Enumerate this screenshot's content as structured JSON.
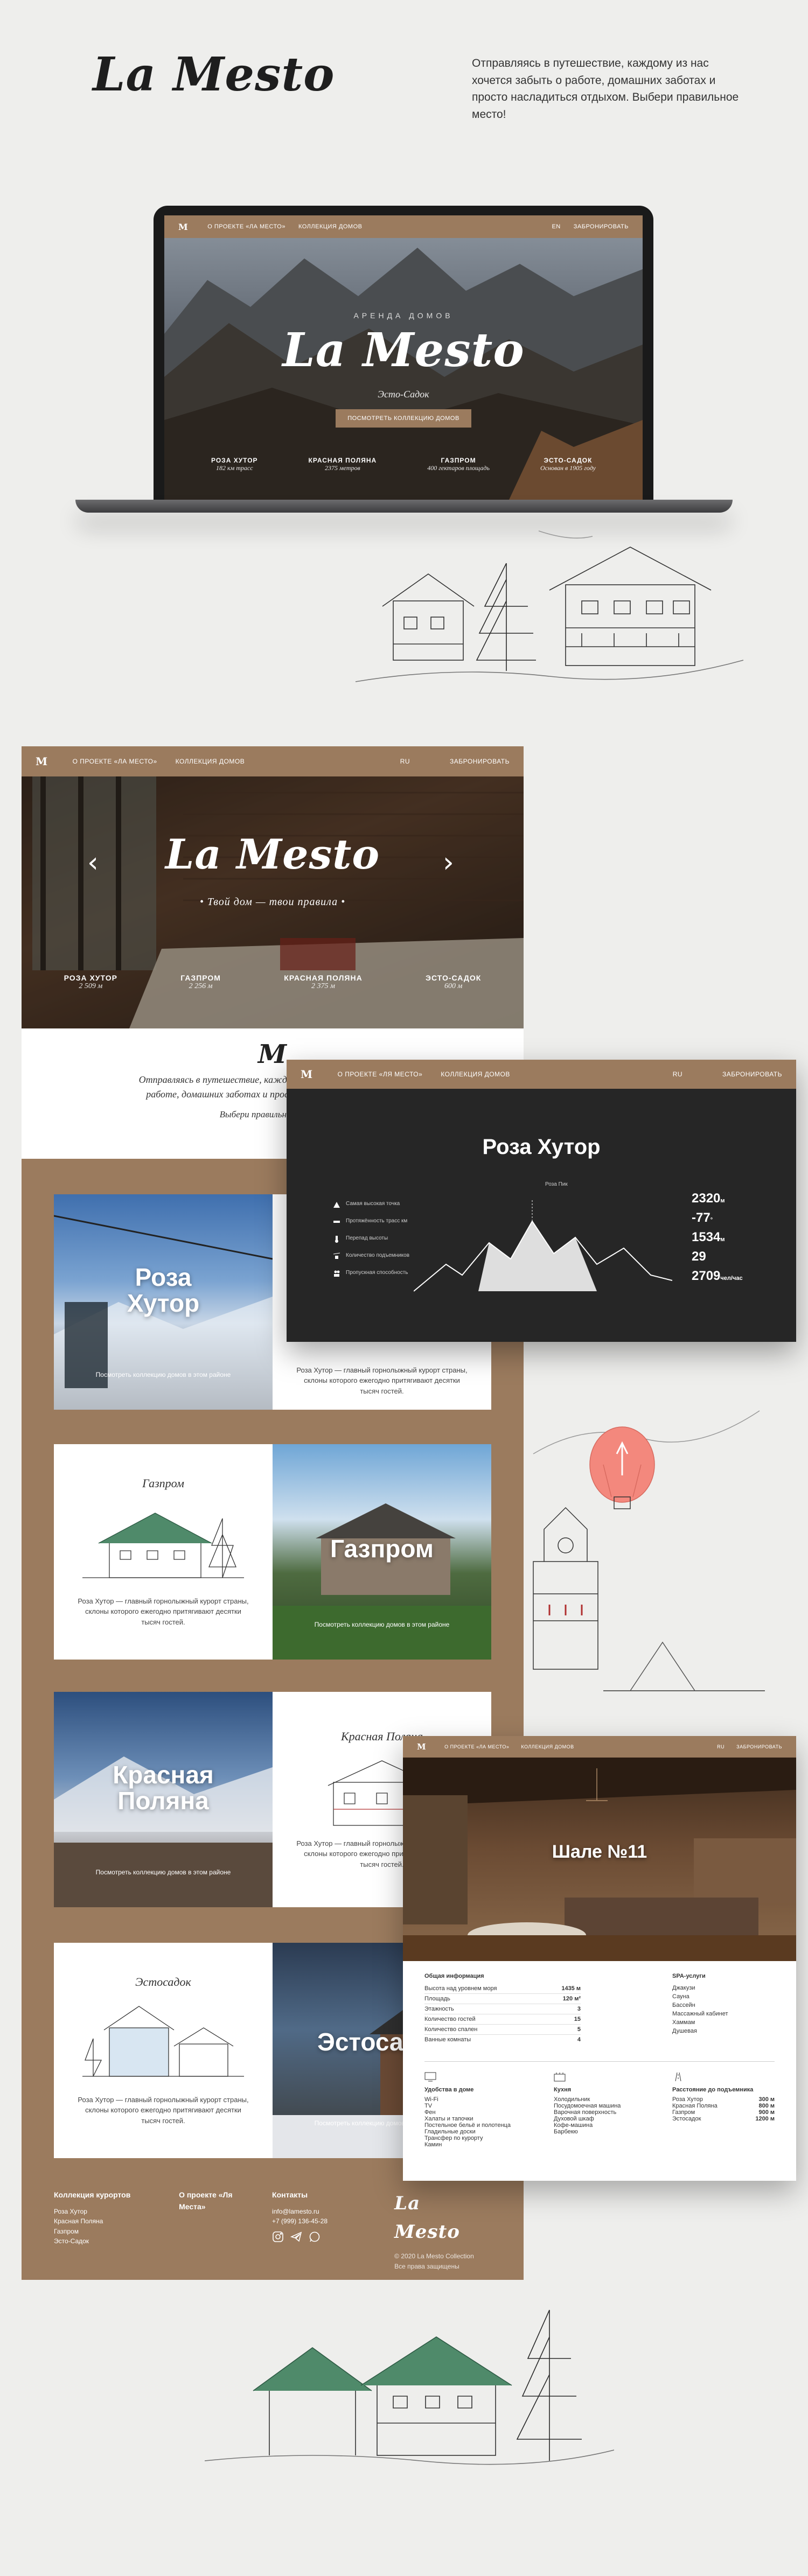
{
  "header": {
    "logo": "La Mesto",
    "tagline": "Отправляясь в путешествие, каждому из нас хочется забыть о работе, домашних заботах и просто насладиться отдыхом. Выбери правильное место!"
  },
  "laptop": {
    "nav": {
      "logo": "M",
      "about": "О ПРОЕКТЕ «ЛА МЕСТО»",
      "collection": "КОЛЛЕКЦИЯ ДОМОВ",
      "lang": "EN",
      "book": "ЗАБРОНИРОВАТЬ"
    },
    "hero": {
      "eyebrow": "АРЕНДА ДОМОВ",
      "title": "La Mesto",
      "subtitle": "Эсто-Садок",
      "button": "ПОСМОТРЕТЬ КОЛЛЕКЦИЮ ДОМОВ"
    },
    "stats": [
      {
        "title": "РОЗА ХУТОР",
        "value": "182 км трасс"
      },
      {
        "title": "КРАСНАЯ ПОЛЯНА",
        "value": "2375 метров"
      },
      {
        "title": "ГАЗПРОМ",
        "value": "400 гектаров площадь"
      },
      {
        "title": "ЭСТО-САДОК",
        "value": "Основан в 1905 году"
      }
    ]
  },
  "site": {
    "nav": {
      "logo": "M",
      "about": "О ПРОЕКТЕ «ЛА МЕСТО»",
      "collection": "КОЛЛЕКЦИЯ ДОМОВ",
      "lang": "RU",
      "book": "ЗАБРОНИРОВАТЬ"
    },
    "hero": {
      "title": "La Mesto",
      "slogan": "• Твой дом — твои правила •",
      "prev": "‹",
      "next": "›"
    },
    "stats": [
      {
        "title": "РОЗА ХУТОР",
        "value": "2 509 м"
      },
      {
        "title": "ГАЗПРОМ",
        "value": "2 256 м"
      },
      {
        "title": "КРАСНАЯ ПОЛЯНА",
        "value": "2 375 м"
      },
      {
        "title": "ЭСТО-САДОК",
        "value": "600 м"
      }
    ],
    "intro": {
      "logo": "M",
      "text": "Отправляясь в путешествие, каждому из нас хочется забыть о работе, домашних заботах и просто насладиться отдыхом.",
      "cta": "Выбери правильное место!"
    },
    "cards": [
      {
        "photo_title": "Роза Хутор",
        "photo_caption": "Посмотреть коллекцию домов в этом районе",
        "sketch_title": "",
        "desc": "Роза Хутор — главный горнолыжный курорт страны, склоны которого ежегодно притягивают десятки тысяч гостей."
      },
      {
        "photo_title": "Газпром",
        "photo_caption": "Посмотреть коллекцию домов в этом районе",
        "sketch_title": "Газпром",
        "desc": "Роза Хутор — главный горнолыжный курорт страны, склоны которого ежегодно притягивают десятки тысяч гостей."
      },
      {
        "photo_title": "Красная Поляна",
        "photo_caption": "Посмотреть коллекцию домов в этом районе",
        "sketch_title": "Красная Поляна",
        "desc": "Роза Хутор — главный горнолыжный курорт страны, склоны которого ежегодно притягивают десятки тысяч гостей."
      },
      {
        "photo_title": "Эстосадок",
        "photo_caption": "Посмотреть коллекцию домов в этом районе",
        "sketch_title": "Эстосадок",
        "desc": "Роза Хутор — главный горнолыжный курорт страны, склоны которого ежегодно притягивают десятки тысяч гостей."
      }
    ],
    "footer": {
      "col1_title": "Коллекция курортов",
      "col1_items": [
        "Роза Хутор",
        "Красная Поляна",
        "Газпром",
        "Эсто-Садок"
      ],
      "col2_title": "О проекте «Ля Места»",
      "col3_title": "Контакты",
      "email": "info@lamesto.ru",
      "phone": "+7 (999) 136-45-28",
      "logo": "La Mesto",
      "copyright": "© 2020 La Mesto Collection",
      "rights": "Все права защищены"
    }
  },
  "resort": {
    "nav": {
      "logo": "M",
      "about": "О ПРОЕКТЕ «ЛЯ МЕСТО»",
      "collection": "КОЛЛЕКЦИЯ ДОМОВ",
      "lang": "RU",
      "book": "ЗАБРОНИРОВАТЬ"
    },
    "title": "Роза Хутор",
    "peak": "Роза Пик",
    "legend": [
      {
        "icon": "mountain-icon",
        "label": "Самая высокая точка"
      },
      {
        "icon": "ruler-icon",
        "label": "Протяжённость трасс км"
      },
      {
        "icon": "thermometer-icon",
        "label": "Перепад высоты"
      },
      {
        "icon": "lift-icon",
        "label": "Количество подъемников"
      },
      {
        "icon": "people-icon",
        "label": "Пропускная способность"
      }
    ],
    "numbers": [
      {
        "value": "2320",
        "unit": "м"
      },
      {
        "value": "-77",
        "unit": "°"
      },
      {
        "value": "1534",
        "unit": "м"
      },
      {
        "value": "29",
        "unit": ""
      },
      {
        "value": "2709",
        "unit": "чел/час"
      }
    ]
  },
  "house": {
    "nav": {
      "logo": "M",
      "about": "О ПРОЕКТЕ «ЛА МЕСТО»",
      "collection": "КОЛЛЕКЦИЯ ДОМОВ",
      "lang": "RU",
      "book": "ЗАБРОНИРОВАТЬ"
    },
    "title": "Шале №11",
    "general_title": "Общая информация",
    "general": [
      {
        "label": "Высота над уровнем моря",
        "value": "1435 м"
      },
      {
        "label": "Площадь",
        "value": "120 м²"
      },
      {
        "label": "Этажность",
        "value": "3"
      },
      {
        "label": "Количество гостей",
        "value": "15"
      },
      {
        "label": "Количество спален",
        "value": "5"
      },
      {
        "label": "Ванные комнаты",
        "value": "4"
      }
    ],
    "spa_title": "SPA-услуги",
    "spa": [
      "Джакузи",
      "Сауна",
      "Бассейн",
      "Массажный кабинет",
      "Хаммам",
      "Душевая"
    ],
    "facilities": [
      {
        "icon": "tv-icon",
        "title": "Удобства в доме",
        "items": [
          "Wi-Fi",
          "TV",
          "Фен",
          "Халаты и тапочки",
          "Постельное бельё и полотенца",
          "Гладильные доски",
          "Трансфер по курорту",
          "Камин"
        ]
      },
      {
        "icon": "kitchen-icon",
        "title": "Кухня",
        "items": [
          "Холодильник",
          "Посудомоечная машина",
          "Варочная поверхность",
          "Духовой шкаф",
          "Кофе-машина",
          "Барбекю"
        ]
      },
      {
        "icon": "road-icon",
        "title": "Расстояние до подъемника",
        "items": [
          "Роза Хутор",
          "Красная Поляна",
          "Газпром",
          "Эстосадок"
        ],
        "values": [
          "300 м",
          "800 м",
          "900 м",
          "1200 м"
        ]
      }
    ]
  },
  "colors": {
    "brand": "#9b7b5e",
    "dark": "#262626",
    "bg": "#eeeeec",
    "balloon": "#f3887d"
  }
}
